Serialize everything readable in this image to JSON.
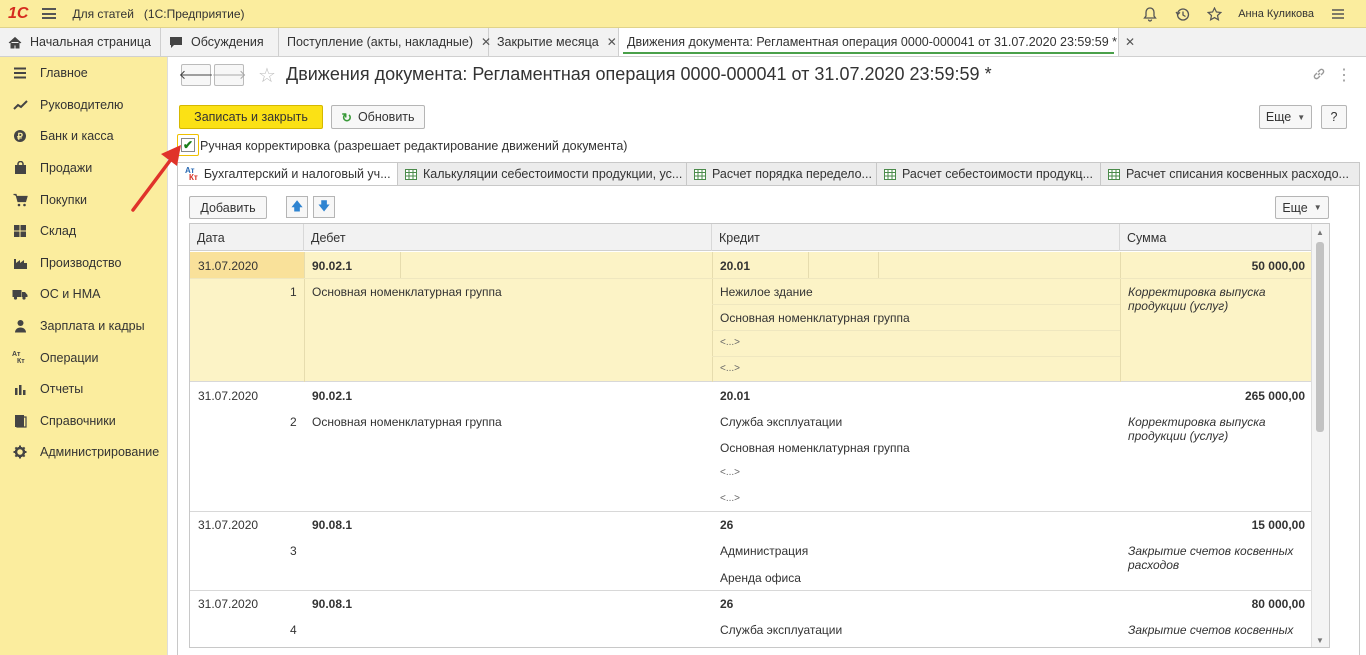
{
  "app": {
    "logo": "1С",
    "title": "Для статей   (1С:Предприятие)",
    "user": "Анна Куликова"
  },
  "tabs": [
    {
      "label": "Начальная страница"
    },
    {
      "label": "Обсуждения"
    },
    {
      "label": "Поступление (акты, накладные)"
    },
    {
      "label": "Закрытие месяца"
    },
    {
      "label": "Движения документа: Регламентная операция 0000-000041 от 31.07.2020 23:59:59 *"
    }
  ],
  "sidebar": {
    "items": [
      {
        "label": "Главное",
        "icon": "menu-icon"
      },
      {
        "label": "Руководителю",
        "icon": "trend-icon"
      },
      {
        "label": "Банк и касса",
        "icon": "coin-icon"
      },
      {
        "label": "Продажи",
        "icon": "bag-icon"
      },
      {
        "label": "Покупки",
        "icon": "cart-icon"
      },
      {
        "label": "Склад",
        "icon": "warehouse-icon"
      },
      {
        "label": "Производство",
        "icon": "factory-icon"
      },
      {
        "label": "ОС и НМА",
        "icon": "truck-icon"
      },
      {
        "label": "Зарплата и кадры",
        "icon": "person-icon"
      },
      {
        "label": "Операции",
        "icon": "dt-kt-icon"
      },
      {
        "label": "Отчеты",
        "icon": "bar-chart-icon"
      },
      {
        "label": "Справочники",
        "icon": "book-icon"
      },
      {
        "label": "Администрирование",
        "icon": "gear-icon"
      }
    ]
  },
  "document": {
    "title": "Движения документа: Регламентная операция 0000-000041 от 31.07.2020 23:59:59 *",
    "save_close": "Записать и закрыть",
    "refresh": "Обновить",
    "more": "Еще",
    "help": "?",
    "manual_check_label": "Ручная корректировка (разрешает редактирование движений документа)",
    "manual_checked": true
  },
  "subtabs": [
    {
      "label": "Бухгалтерский и налоговый уч..."
    },
    {
      "label": "Калькуляции себестоимости продукции, ус..."
    },
    {
      "label": "Расчет порядка передело..."
    },
    {
      "label": "Расчет себестоимости продукц..."
    },
    {
      "label": "Расчет списания косвенных расходо..."
    }
  ],
  "grid_toolbar": {
    "add": "Добавить",
    "more": "Еще"
  },
  "grid": {
    "headers": [
      "Дата",
      "Дебет",
      "Кредит",
      "Сумма"
    ],
    "records": [
      {
        "date": "31.07.2020",
        "num": "1",
        "debit": "90.02.1",
        "debit_sub": [
          "Основная номенклатурная группа"
        ],
        "credit": "20.01",
        "credit_sub": [
          "Нежилое здание",
          "Основная номенклатурная группа",
          "<...>",
          "<...>"
        ],
        "sum": "50 000,00",
        "content": "Корректировка выпуска продукции (услуг)"
      },
      {
        "date": "31.07.2020",
        "num": "2",
        "debit": "90.02.1",
        "debit_sub": [
          "Основная номенклатурная группа"
        ],
        "credit": "20.01",
        "credit_sub": [
          "Служба эксплуатации",
          "Основная номенклатурная группа",
          "<...>",
          "<...>"
        ],
        "sum": "265 000,00",
        "content": "Корректировка выпуска продукции (услуг)"
      },
      {
        "date": "31.07.2020",
        "num": "3",
        "debit": "90.08.1",
        "debit_sub": [],
        "credit": "26",
        "credit_sub": [
          "Администрация",
          "Аренда офиса"
        ],
        "sum": "15 000,00",
        "content": "Закрытие счетов косвенных расходов"
      },
      {
        "date": "31.07.2020",
        "num": "4",
        "debit": "90.08.1",
        "debit_sub": [],
        "credit": "26",
        "credit_sub": [
          "Служба эксплуатации"
        ],
        "sum": "80 000,00",
        "content": "Закрытие счетов косвенных"
      }
    ]
  }
}
